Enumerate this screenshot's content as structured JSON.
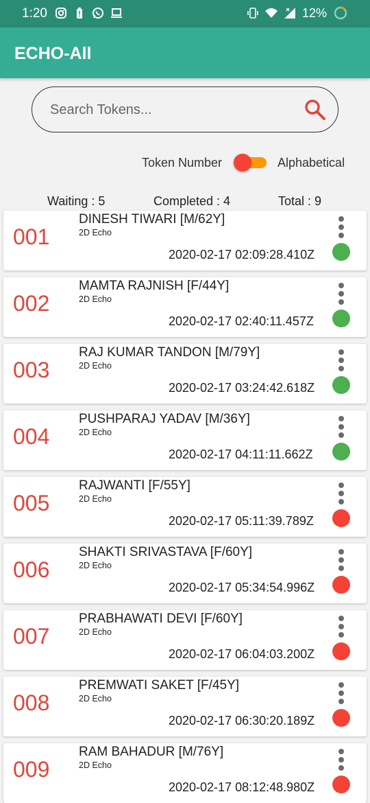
{
  "status_bar": {
    "time": "1:20",
    "battery": "12%"
  },
  "app_bar": {
    "title": "ECHO-All"
  },
  "search": {
    "placeholder": "Search Tokens..."
  },
  "sort": {
    "left_label": "Token Number",
    "right_label": "Alphabetical"
  },
  "counts": {
    "waiting": "Waiting : 5",
    "completed": "Completed : 4",
    "total": "Total : 9"
  },
  "colors": {
    "completed": "#4caf50",
    "waiting": "#f44336",
    "token": "#e0463c",
    "app_bar": "#35ad94",
    "status_bar": "#2b8c75"
  },
  "tokens": [
    {
      "number": "001",
      "name": "DINESH TIWARI [M/62Y]",
      "type": "2D Echo",
      "time": "2020-02-17 02:09:28.410Z",
      "status": "completed"
    },
    {
      "number": "002",
      "name": "MAMTA RAJNISH [F/44Y]",
      "type": "2D Echo",
      "time": "2020-02-17 02:40:11.457Z",
      "status": "completed"
    },
    {
      "number": "003",
      "name": "RAJ KUMAR TANDON [M/79Y]",
      "type": "2D Echo",
      "time": "2020-02-17 03:24:42.618Z",
      "status": "completed"
    },
    {
      "number": "004",
      "name": "PUSHPARAJ YADAV [M/36Y]",
      "type": "2D Echo",
      "time": "2020-02-17 04:11:11.662Z",
      "status": "completed"
    },
    {
      "number": "005",
      "name": "RAJWANTI [F/55Y]",
      "type": "2D Echo",
      "time": "2020-02-17 05:11:39.789Z",
      "status": "waiting"
    },
    {
      "number": "006",
      "name": "SHAKTI SRIVASTAVA [F/60Y]",
      "type": "2D Echo",
      "time": "2020-02-17 05:34:54.996Z",
      "status": "waiting"
    },
    {
      "number": "007",
      "name": "PRABHAWATI DEVI [F/60Y]",
      "type": "2D Echo",
      "time": "2020-02-17 06:04:03.200Z",
      "status": "waiting"
    },
    {
      "number": "008",
      "name": "PREMWATI SAKET [F/45Y]",
      "type": "2D Echo",
      "time": "2020-02-17 06:30:20.189Z",
      "status": "waiting"
    },
    {
      "number": "009",
      "name": "RAM BAHADUR [M/76Y]",
      "type": "2D Echo",
      "time": "2020-02-17 08:12:48.980Z",
      "status": "waiting"
    }
  ]
}
